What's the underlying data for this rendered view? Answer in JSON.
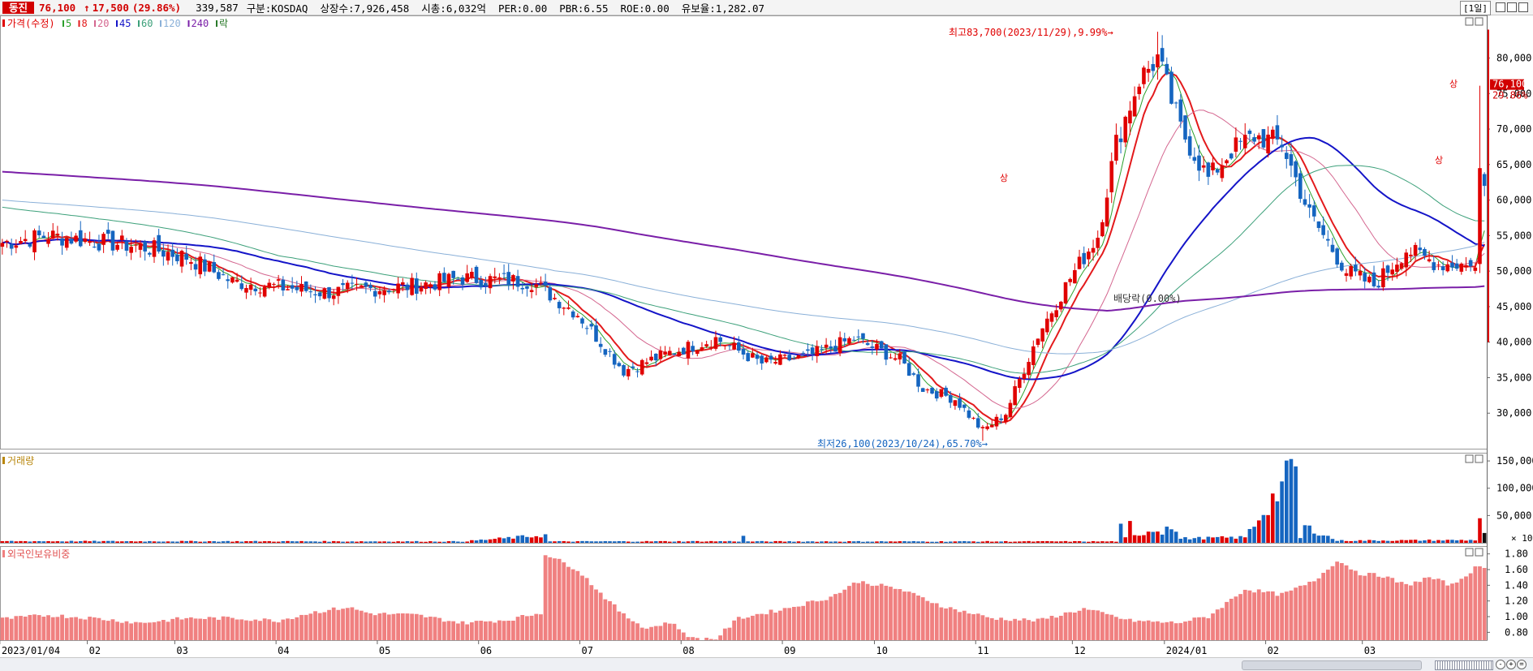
{
  "header": {
    "name": "동진",
    "price": "76,100",
    "change_arrow": "↑",
    "change": "17,500",
    "change_pct": "(29.86%)",
    "volume": "339,587",
    "info": "구분:KOSDAQ  상장수:7,926,458  시총:6,032억  PER:0.00  PBR:6.55  ROE:0.00  유보율:1,282.07",
    "period": "[1일]"
  },
  "legend": {
    "price_label": "가격(수정)",
    "ma": [
      {
        "label": "5",
        "color": "#2ca02c"
      },
      {
        "label": "8",
        "color": "#e31a1c"
      },
      {
        "label": "20",
        "color": "#d4668f"
      },
      {
        "label": "45",
        "color": "#1414c8"
      },
      {
        "label": "60",
        "color": "#3ca07a"
      },
      {
        "label": "120",
        "color": "#8ab0d8"
      },
      {
        "label": "240",
        "color": "#7a1fa8"
      }
    ],
    "ex_label": "락",
    "volume_label": "거래량",
    "foreign_label": "외국인보유비중"
  },
  "colors": {
    "up": "#e00000",
    "down": "#1565c0",
    "foreign_bar": "#f08080",
    "price_tag": "#d20000"
  },
  "chart_data": [
    {
      "type": "candlestick",
      "title": "가격(수정)",
      "x_ticks": [
        "2023/01/04",
        "02",
        "03",
        "04",
        "05",
        "06",
        "07",
        "08",
        "09",
        "10",
        "11",
        "12",
        "2024/01",
        "02",
        "03"
      ],
      "y_ticks": [
        "30,000",
        "35,000",
        "40,000",
        "45,000",
        "50,000",
        "55,000",
        "60,000",
        "65,000",
        "70,000",
        "75,000",
        "80,000"
      ],
      "ylim": [
        25000,
        86000
      ],
      "high_annotation": "최고83,700(2023/11/29),9.99%→",
      "low_annotation": "최저26,100(2023/10/24),65.70%→",
      "mid_annotation": "배당락(0.00%)",
      "up_markers": [
        "상",
        "상",
        "상"
      ],
      "last_price_tag": "76,100",
      "last_pct_tag": "29.86%",
      "close_anchors": [
        [
          0,
          54000
        ],
        [
          10,
          55000
        ],
        [
          20,
          54200
        ],
        [
          30,
          53500
        ],
        [
          40,
          52000
        ],
        [
          50,
          48500
        ],
        [
          57,
          48000
        ],
        [
          70,
          47000
        ],
        [
          80,
          47500
        ],
        [
          90,
          48000
        ],
        [
          100,
          49000
        ],
        [
          115,
          48500
        ],
        [
          125,
          44000
        ],
        [
          135,
          36000
        ],
        [
          145,
          38500
        ],
        [
          155,
          40500
        ],
        [
          165,
          37000
        ],
        [
          175,
          38000
        ],
        [
          185,
          40500
        ],
        [
          195,
          37500
        ],
        [
          200,
          33500
        ],
        [
          207,
          32000
        ],
        [
          213,
          27500
        ],
        [
          218,
          30000
        ],
        [
          225,
          41000
        ],
        [
          232,
          49000
        ],
        [
          238,
          55000
        ],
        [
          242,
          68000
        ],
        [
          247,
          77000
        ],
        [
          251,
          80000
        ],
        [
          256,
          70000
        ],
        [
          262,
          63000
        ],
        [
          267,
          67000
        ],
        [
          272,
          69000
        ],
        [
          278,
          68000
        ],
        [
          284,
          58000
        ],
        [
          292,
          50000
        ],
        [
          298,
          48000
        ],
        [
          305,
          53000
        ],
        [
          312,
          51000
        ],
        [
          317,
          51000
        ],
        [
          320,
          50500
        ],
        [
          321,
          64500
        ],
        [
          322,
          62000
        ]
      ],
      "ma_start": {
        "ma240": 64000,
        "ma120": 60000,
        "ma60": 59000
      }
    },
    {
      "type": "bar",
      "title": "거래량",
      "y_ticks": [
        "50,000",
        "100,000",
        "150,000"
      ],
      "ylim": [
        0,
        165000
      ],
      "unit": "× 10"
    },
    {
      "type": "bar",
      "title": "외국인보유비중",
      "y_ticks": [
        "0.80",
        "1.00",
        "1.20",
        "1.40",
        "1.60",
        "1.80"
      ],
      "ylim": [
        0.7,
        1.9
      ],
      "anchors": [
        [
          0,
          0.97
        ],
        [
          10,
          1.02
        ],
        [
          20,
          0.98
        ],
        [
          30,
          0.92
        ],
        [
          40,
          0.98
        ],
        [
          50,
          0.98
        ],
        [
          60,
          0.95
        ],
        [
          67,
          1.05
        ],
        [
          75,
          1.12
        ],
        [
          80,
          1.04
        ],
        [
          90,
          1.02
        ],
        [
          100,
          0.92
        ],
        [
          110,
          0.96
        ],
        [
          117,
          1.05
        ],
        [
          118,
          1.8
        ],
        [
          125,
          1.6
        ],
        [
          130,
          1.3
        ],
        [
          135,
          1.02
        ],
        [
          140,
          0.85
        ],
        [
          145,
          0.93
        ],
        [
          150,
          0.72
        ],
        [
          155,
          0.72
        ],
        [
          160,
          0.98
        ],
        [
          170,
          1.1
        ],
        [
          180,
          1.25
        ],
        [
          186,
          1.45
        ],
        [
          195,
          1.35
        ],
        [
          205,
          1.12
        ],
        [
          215,
          0.98
        ],
        [
          225,
          0.95
        ],
        [
          235,
          1.1
        ],
        [
          245,
          0.95
        ],
        [
          255,
          0.92
        ],
        [
          262,
          1.0
        ],
        [
          270,
          1.35
        ],
        [
          278,
          1.28
        ],
        [
          285,
          1.45
        ],
        [
          290,
          1.72
        ],
        [
          295,
          1.55
        ],
        [
          300,
          1.52
        ],
        [
          305,
          1.4
        ],
        [
          310,
          1.5
        ],
        [
          315,
          1.4
        ],
        [
          320,
          1.62
        ],
        [
          322,
          1.62
        ]
      ]
    }
  ]
}
